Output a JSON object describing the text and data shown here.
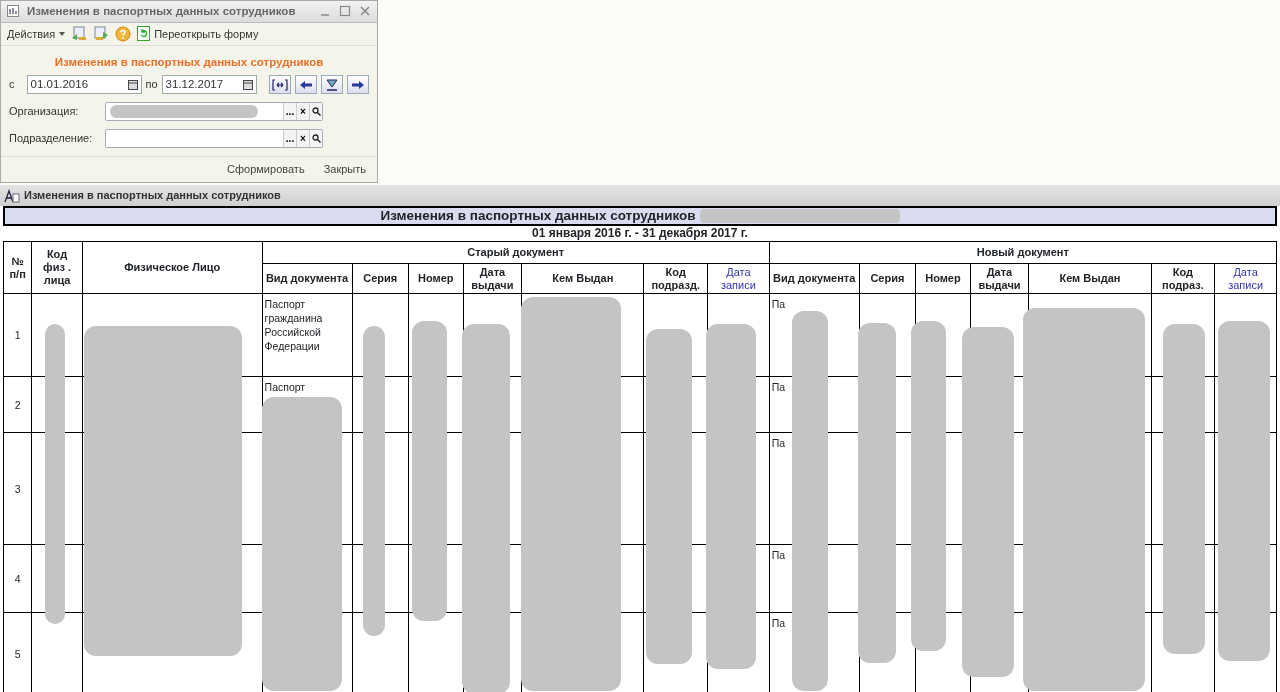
{
  "form_window": {
    "title": "Изменения в паспортных данных сотрудников",
    "toolbar": {
      "actions_menu": "Действия",
      "reopen_button": "Переоткрыть форму"
    },
    "heading": "Изменения в паспортных данных сотрудников",
    "period": {
      "from_label": "с",
      "from": "01.01.2016",
      "to_label": "по",
      "to": "31.12.2017"
    },
    "fields": [
      {
        "label": "Организация:",
        "redacted": true,
        "buttons": [
          "...",
          "×"
        ]
      },
      {
        "label": "Подразделение:",
        "redacted": false,
        "buttons": [
          "...",
          "×"
        ]
      }
    ],
    "footer_buttons": [
      "Сформировать",
      "Закрыть"
    ]
  },
  "report_window": {
    "title": "Изменения в паспортных данных сотрудников"
  },
  "report": {
    "title": "Изменения в паспортных данных сотрудников",
    "title_redacted": true,
    "period": "01 января 2016 г. - 31 декабря 2017 г.",
    "fixed_columns": [
      "№ п/п",
      "Код физ . лица",
      "Физическое Лицо"
    ],
    "groups": [
      {
        "title": "Старый документ",
        "columns": [
          {
            "label": "Вид документа",
            "kind": "text"
          },
          {
            "label": "Серия",
            "kind": "text"
          },
          {
            "label": "Номер",
            "kind": "text"
          },
          {
            "label": "Дата выдачи",
            "kind": "text"
          },
          {
            "label": "Кем Выдан",
            "kind": "text"
          },
          {
            "label": "Код подразд.",
            "kind": "text"
          },
          {
            "label": "Дата записи",
            "kind": "link"
          }
        ]
      },
      {
        "title": "Новый документ",
        "columns": [
          {
            "label": "Вид документа",
            "kind": "text"
          },
          {
            "label": "Серия",
            "kind": "text"
          },
          {
            "label": "Номер",
            "kind": "text"
          },
          {
            "label": "Дата выдачи",
            "kind": "text"
          },
          {
            "label": "Кем Выдан",
            "kind": "text"
          },
          {
            "label": "Код подраз.",
            "kind": "text"
          },
          {
            "label": "Дата записи",
            "kind": "link"
          }
        ]
      }
    ],
    "rows": [
      {
        "number": "1",
        "old_doc_type": "Паспорт гражданина Российской Федерации",
        "new_doc_type": "Па"
      },
      {
        "number": "2",
        "old_doc_type": "Паспорт",
        "new_doc_type": "Па"
      },
      {
        "number": "3",
        "new_doc_type": "Па"
      },
      {
        "number": "4",
        "new_doc_type": "Па"
      },
      {
        "number": "5",
        "new_doc_type": "Па"
      }
    ],
    "redacted": true
  }
}
